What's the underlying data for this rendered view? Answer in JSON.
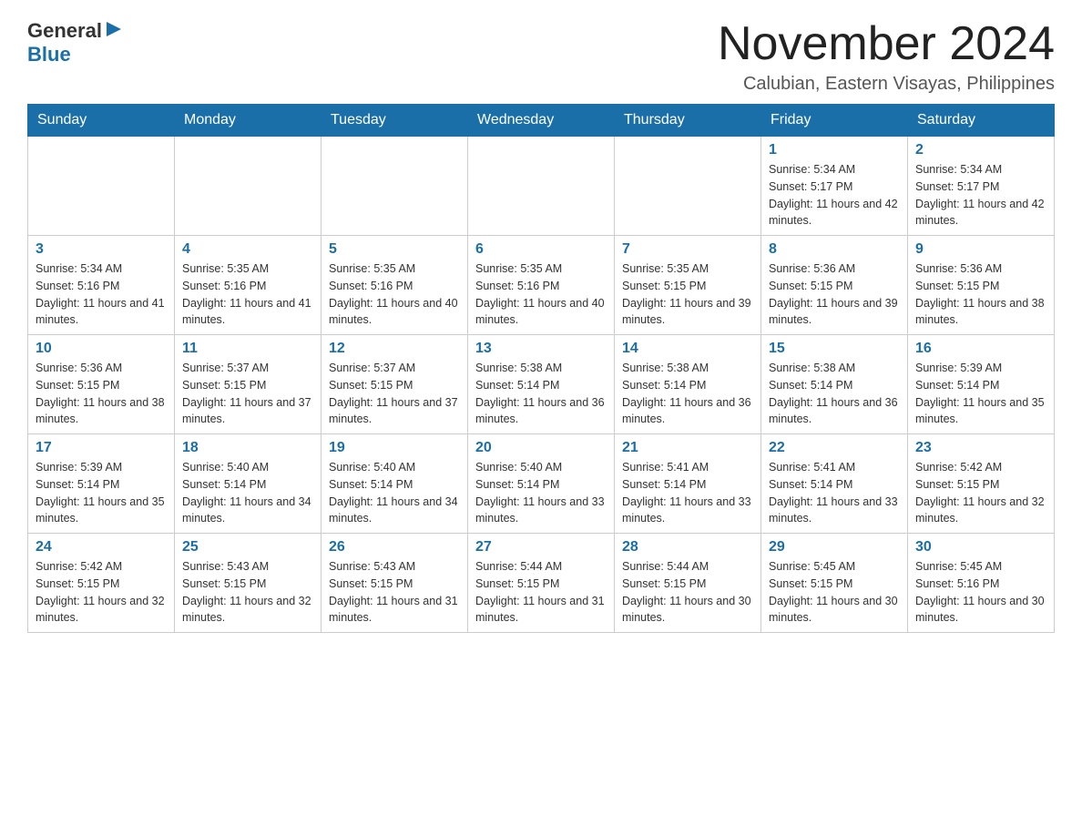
{
  "logo": {
    "text_general": "General",
    "text_blue": "Blue"
  },
  "header": {
    "title": "November 2024",
    "subtitle": "Calubian, Eastern Visayas, Philippines"
  },
  "days_of_week": [
    "Sunday",
    "Monday",
    "Tuesday",
    "Wednesday",
    "Thursday",
    "Friday",
    "Saturday"
  ],
  "weeks": [
    [
      {
        "day": "",
        "info": ""
      },
      {
        "day": "",
        "info": ""
      },
      {
        "day": "",
        "info": ""
      },
      {
        "day": "",
        "info": ""
      },
      {
        "day": "",
        "info": ""
      },
      {
        "day": "1",
        "info": "Sunrise: 5:34 AM\nSunset: 5:17 PM\nDaylight: 11 hours and 42 minutes."
      },
      {
        "day": "2",
        "info": "Sunrise: 5:34 AM\nSunset: 5:17 PM\nDaylight: 11 hours and 42 minutes."
      }
    ],
    [
      {
        "day": "3",
        "info": "Sunrise: 5:34 AM\nSunset: 5:16 PM\nDaylight: 11 hours and 41 minutes."
      },
      {
        "day": "4",
        "info": "Sunrise: 5:35 AM\nSunset: 5:16 PM\nDaylight: 11 hours and 41 minutes."
      },
      {
        "day": "5",
        "info": "Sunrise: 5:35 AM\nSunset: 5:16 PM\nDaylight: 11 hours and 40 minutes."
      },
      {
        "day": "6",
        "info": "Sunrise: 5:35 AM\nSunset: 5:16 PM\nDaylight: 11 hours and 40 minutes."
      },
      {
        "day": "7",
        "info": "Sunrise: 5:35 AM\nSunset: 5:15 PM\nDaylight: 11 hours and 39 minutes."
      },
      {
        "day": "8",
        "info": "Sunrise: 5:36 AM\nSunset: 5:15 PM\nDaylight: 11 hours and 39 minutes."
      },
      {
        "day": "9",
        "info": "Sunrise: 5:36 AM\nSunset: 5:15 PM\nDaylight: 11 hours and 38 minutes."
      }
    ],
    [
      {
        "day": "10",
        "info": "Sunrise: 5:36 AM\nSunset: 5:15 PM\nDaylight: 11 hours and 38 minutes."
      },
      {
        "day": "11",
        "info": "Sunrise: 5:37 AM\nSunset: 5:15 PM\nDaylight: 11 hours and 37 minutes."
      },
      {
        "day": "12",
        "info": "Sunrise: 5:37 AM\nSunset: 5:15 PM\nDaylight: 11 hours and 37 minutes."
      },
      {
        "day": "13",
        "info": "Sunrise: 5:38 AM\nSunset: 5:14 PM\nDaylight: 11 hours and 36 minutes."
      },
      {
        "day": "14",
        "info": "Sunrise: 5:38 AM\nSunset: 5:14 PM\nDaylight: 11 hours and 36 minutes."
      },
      {
        "day": "15",
        "info": "Sunrise: 5:38 AM\nSunset: 5:14 PM\nDaylight: 11 hours and 36 minutes."
      },
      {
        "day": "16",
        "info": "Sunrise: 5:39 AM\nSunset: 5:14 PM\nDaylight: 11 hours and 35 minutes."
      }
    ],
    [
      {
        "day": "17",
        "info": "Sunrise: 5:39 AM\nSunset: 5:14 PM\nDaylight: 11 hours and 35 minutes."
      },
      {
        "day": "18",
        "info": "Sunrise: 5:40 AM\nSunset: 5:14 PM\nDaylight: 11 hours and 34 minutes."
      },
      {
        "day": "19",
        "info": "Sunrise: 5:40 AM\nSunset: 5:14 PM\nDaylight: 11 hours and 34 minutes."
      },
      {
        "day": "20",
        "info": "Sunrise: 5:40 AM\nSunset: 5:14 PM\nDaylight: 11 hours and 33 minutes."
      },
      {
        "day": "21",
        "info": "Sunrise: 5:41 AM\nSunset: 5:14 PM\nDaylight: 11 hours and 33 minutes."
      },
      {
        "day": "22",
        "info": "Sunrise: 5:41 AM\nSunset: 5:14 PM\nDaylight: 11 hours and 33 minutes."
      },
      {
        "day": "23",
        "info": "Sunrise: 5:42 AM\nSunset: 5:15 PM\nDaylight: 11 hours and 32 minutes."
      }
    ],
    [
      {
        "day": "24",
        "info": "Sunrise: 5:42 AM\nSunset: 5:15 PM\nDaylight: 11 hours and 32 minutes."
      },
      {
        "day": "25",
        "info": "Sunrise: 5:43 AM\nSunset: 5:15 PM\nDaylight: 11 hours and 32 minutes."
      },
      {
        "day": "26",
        "info": "Sunrise: 5:43 AM\nSunset: 5:15 PM\nDaylight: 11 hours and 31 minutes."
      },
      {
        "day": "27",
        "info": "Sunrise: 5:44 AM\nSunset: 5:15 PM\nDaylight: 11 hours and 31 minutes."
      },
      {
        "day": "28",
        "info": "Sunrise: 5:44 AM\nSunset: 5:15 PM\nDaylight: 11 hours and 30 minutes."
      },
      {
        "day": "29",
        "info": "Sunrise: 5:45 AM\nSunset: 5:15 PM\nDaylight: 11 hours and 30 minutes."
      },
      {
        "day": "30",
        "info": "Sunrise: 5:45 AM\nSunset: 5:16 PM\nDaylight: 11 hours and 30 minutes."
      }
    ]
  ]
}
